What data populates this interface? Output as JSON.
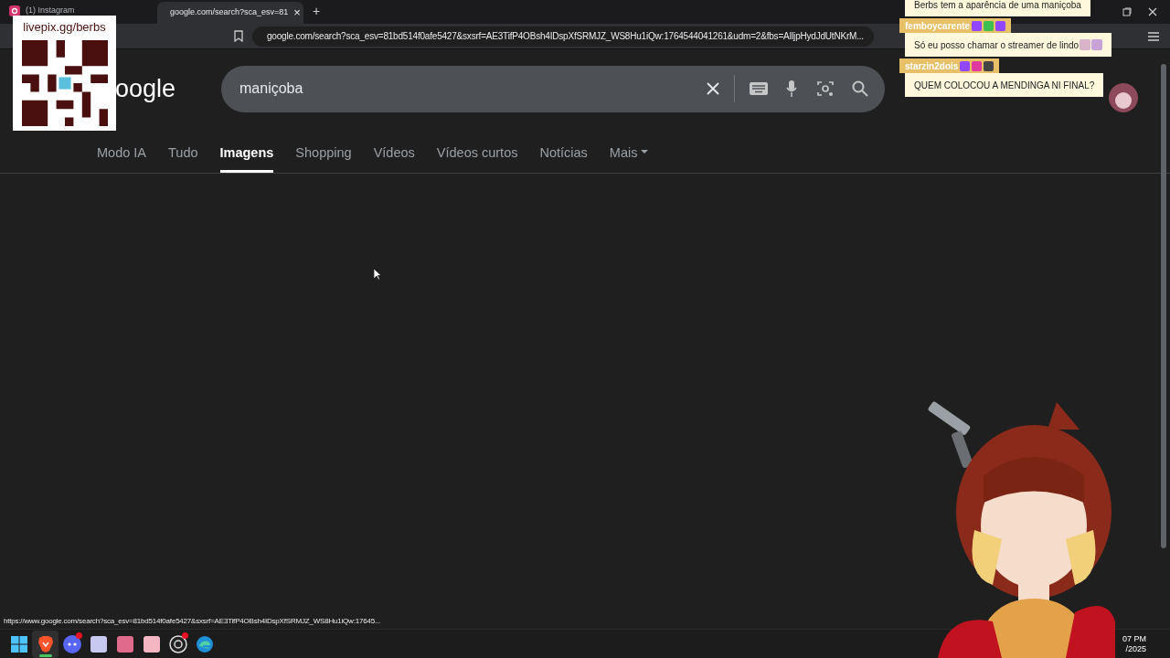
{
  "browser": {
    "tabs": [
      {
        "label": "(1) Instagram",
        "selected": false,
        "kind": "instagram"
      },
      {
        "label": "google.com/search?sca_esv=81",
        "selected": true,
        "kind": "google"
      }
    ],
    "new_tab": "+",
    "close": "×",
    "url": "google.com/search?sca_esv=81bd514f0afe5427&sxsrf=AE3TifP4OBsh4IDspXfSRMJZ_WS8Hu1iQw:1764544041261&udm=2&fbs=AIljpHydJdUtNKrM..."
  },
  "google": {
    "logo": "oogle",
    "query": "maniçoba",
    "nav": [
      {
        "label": "Modo IA",
        "selected": false
      },
      {
        "label": "Tudo",
        "selected": false
      },
      {
        "label": "Imagens",
        "selected": true
      },
      {
        "label": "Shopping",
        "selected": false
      },
      {
        "label": "Vídeos",
        "selected": false
      },
      {
        "label": "Vídeos curtos",
        "selected": false
      },
      {
        "label": "Notícias",
        "selected": false
      },
      {
        "label": "Mais",
        "selected": false,
        "dropdown": true
      }
    ]
  },
  "status_url": "https://www.google.com/search?sca_esv=81bd514f0afe5427&sxsrf=AE3TifP4OBsh4IDspXfSRMJZ_WS8Hu1iQw:17645...",
  "taskbar": {
    "apps": [
      {
        "kind": "windows",
        "active": false,
        "badge": false
      },
      {
        "kind": "brave",
        "active": true,
        "badge": false
      },
      {
        "kind": "discord",
        "active": false,
        "badge": true
      },
      {
        "kind": "app",
        "active": false,
        "badge": false,
        "color": "#c7c9f0"
      },
      {
        "kind": "app",
        "active": false,
        "badge": false,
        "color": "#e06a8c"
      },
      {
        "kind": "app",
        "active": false,
        "badge": false,
        "color": "#f4b6c2"
      },
      {
        "kind": "obs",
        "active": false,
        "badge": true
      },
      {
        "kind": "edge",
        "active": false,
        "badge": false
      }
    ],
    "time": "07 PM",
    "date": "/2025"
  },
  "overlay": {
    "donation": "livepix.gg/berbs",
    "chat": [
      {
        "text": "Berbs tem a aparência de uma maniçoba"
      },
      {
        "user": "femboycarente",
        "text": "Só eu posso chamar o streamer de lindo",
        "badges": [
          {
            "color": "#9146ff"
          },
          {
            "color": "#3fbf4f"
          },
          {
            "color": "#9146ff"
          }
        ],
        "emotes": [
          {
            "color": "#d9b3c8"
          },
          {
            "color": "#c9a3d8"
          }
        ]
      },
      {
        "user": "starzin2dois",
        "text": "QUEM COLOCOU A MENDINGA NI FINAL?",
        "badges": [
          {
            "color": "#9146ff"
          },
          {
            "color": "#e03aa0"
          },
          {
            "color": "#444444"
          }
        ]
      }
    ]
  }
}
